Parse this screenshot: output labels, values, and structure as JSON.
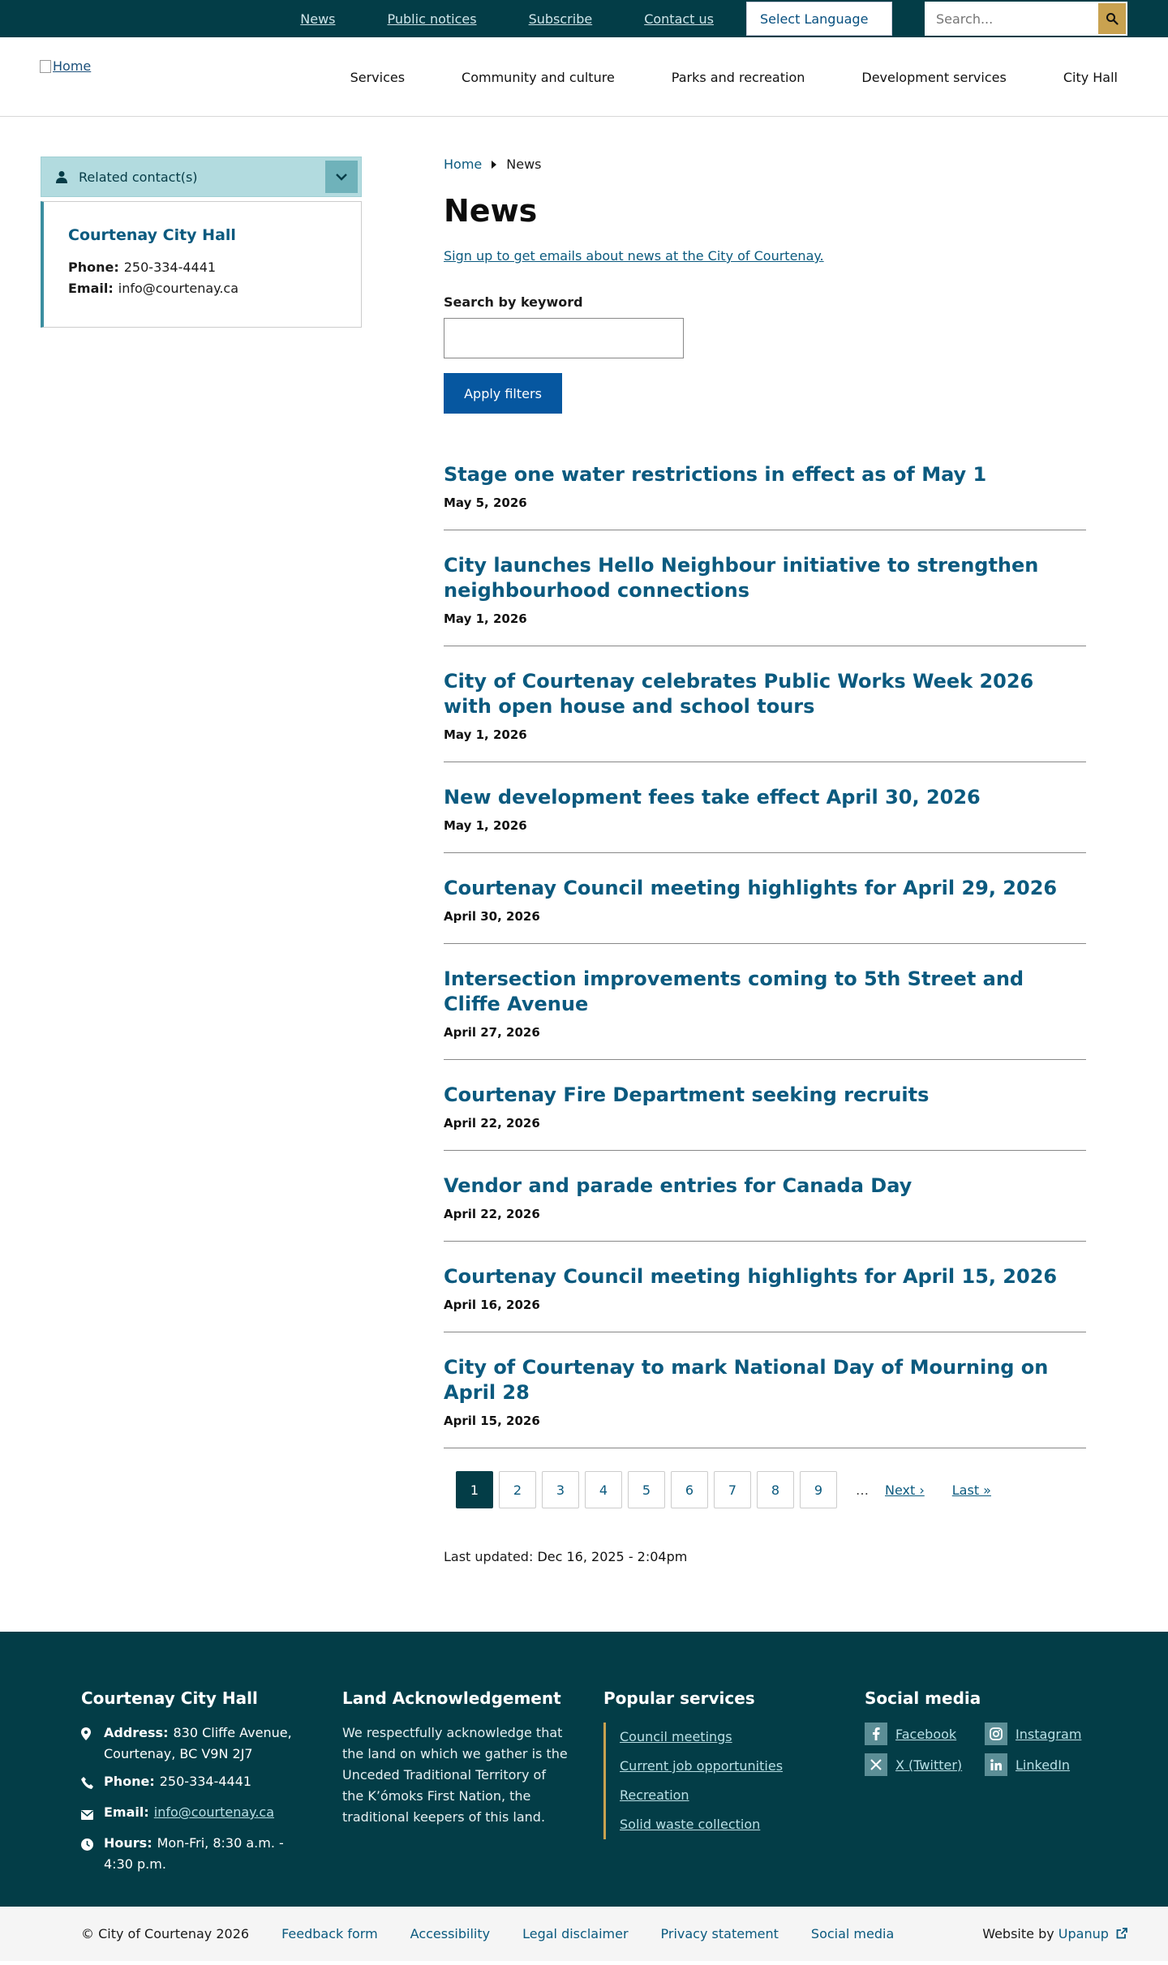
{
  "utility": {
    "links": [
      "News",
      "Public notices",
      "Subscribe",
      "Contact us"
    ],
    "language": "Select Language",
    "search_placeholder": "Search..."
  },
  "header": {
    "logo_alt": "Home",
    "nav": [
      "Services",
      "Community and culture",
      "Parks and recreation",
      "Development services",
      "City Hall"
    ]
  },
  "sidebar": {
    "related_label": "Related contact(s)",
    "contact": {
      "name": "Courtenay City Hall",
      "phone_label": "Phone:",
      "phone": "250-334-4441",
      "email_label": "Email:",
      "email": "info@courtenay.ca"
    }
  },
  "breadcrumb": {
    "home": "Home",
    "current": "News"
  },
  "page_title": "News",
  "signup_link": "Sign up to get emails about news at the City of Courtenay.",
  "filter": {
    "keyword_label": "Search by keyword",
    "keyword_value": "",
    "apply": "Apply filters"
  },
  "news": [
    {
      "title": "Stage one water restrictions in effect as of May 1",
      "date": "May 5, 2026"
    },
    {
      "title": "City launches Hello Neighbour initiative to strengthen neighbourhood connections",
      "date": "May 1, 2026"
    },
    {
      "title": "City of Courtenay celebrates Public Works Week 2026 with open house and school tours",
      "date": "May 1, 2026"
    },
    {
      "title": "New development fees take effect April 30, 2026",
      "date": "May 1, 2026"
    },
    {
      "title": "Courtenay Council meeting highlights for April 29, 2026",
      "date": "April 30, 2026"
    },
    {
      "title": "Intersection improvements coming to 5th Street and Cliffe Avenue",
      "date": "April 27, 2026"
    },
    {
      "title": "Courtenay Fire Department seeking recruits",
      "date": "April 22, 2026"
    },
    {
      "title": "Vendor and parade entries for Canada Day",
      "date": "April 22, 2026"
    },
    {
      "title": "Courtenay Council meeting highlights for April 15, 2026",
      "date": "April 16, 2026"
    },
    {
      "title": "City of Courtenay to mark National Day of Mourning on April 28",
      "date": "April 15, 2026"
    }
  ],
  "pager": {
    "pages": [
      "1",
      "2",
      "3",
      "4",
      "5",
      "6",
      "7",
      "8",
      "9"
    ],
    "current": "1",
    "ellipsis": "…",
    "next": "Next ›",
    "last": "Last »"
  },
  "last_updated": {
    "label": "Last updated:",
    "value": "Dec 16, 2025 - 2:04pm"
  },
  "footer": {
    "city_hall": {
      "heading": "Courtenay City Hall",
      "address_label": "Address:",
      "address": "830 Cliffe Avenue, Courtenay, BC V9N 2J7",
      "phone_label": "Phone:",
      "phone": "250-334-4441",
      "email_label": "Email:",
      "email": "info@courtenay.ca",
      "hours_label": "Hours:",
      "hours": "Mon-Fri, 8:30 a.m. - 4:30 p.m."
    },
    "land": {
      "heading": "Land Acknowledgement",
      "text": "We respectfully acknowledge that the land on which we gather is the Unceded Traditional Territory of the K’ómoks First Nation, the traditional keepers of this land."
    },
    "popular": {
      "heading": "Popular services",
      "links": [
        "Council meetings",
        "Current job opportunities",
        "Recreation",
        "Solid waste collection"
      ]
    },
    "social": {
      "heading": "Social media",
      "links": [
        "Facebook",
        "Instagram",
        "X (Twitter)",
        "LinkedIn"
      ]
    }
  },
  "bottom": {
    "copyright": "© City of Courtenay 2026",
    "links": [
      "Feedback form",
      "Accessibility",
      "Legal disclaimer",
      "Privacy statement",
      "Social media"
    ],
    "website_by": "Website by",
    "agency": "Upanup"
  },
  "colors": {
    "utility_bg": "#033d47",
    "accent_gold": "#c9a250",
    "link_blue": "#0b5a7f",
    "button_blue": "#0657a0"
  }
}
